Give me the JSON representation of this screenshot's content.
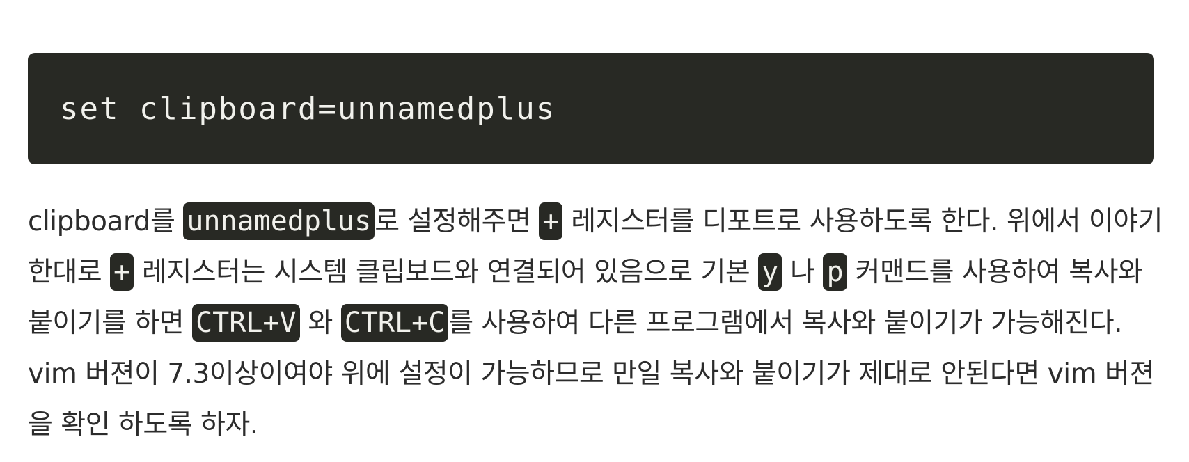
{
  "code_block": {
    "code": "set clipboard=unnamedplus"
  },
  "paragraph": {
    "t1": "clipboard를 ",
    "c1": "unnamedplus",
    "t2": "로 설정해주면 ",
    "c2": "+",
    "t3": " 레지스터를 디포트로 사용하도록 한다. 위에서 이야기 한대로 ",
    "c3": "+",
    "t4": " 레지스터는 시스템 클립보드와 연결되어 있음으로 기본 ",
    "c4": "y",
    "t5": " 나 ",
    "c5": "p",
    "t6": " 커맨드를 사용하여 복사와 붙이기를 하면 ",
    "c6": "CTRL+V",
    "t7": " 와 ",
    "c7": "CTRL+C",
    "t8": "를 사용하여 다른 프로그램에서 복사와 붙이기가 가능해진다. vim 버젼이 7.3이상이여야 위에 설정이 가능하므로 만일 복사와 붙이기가 제대로 안된다면 vim 버젼을 확인 하도록 하자."
  }
}
